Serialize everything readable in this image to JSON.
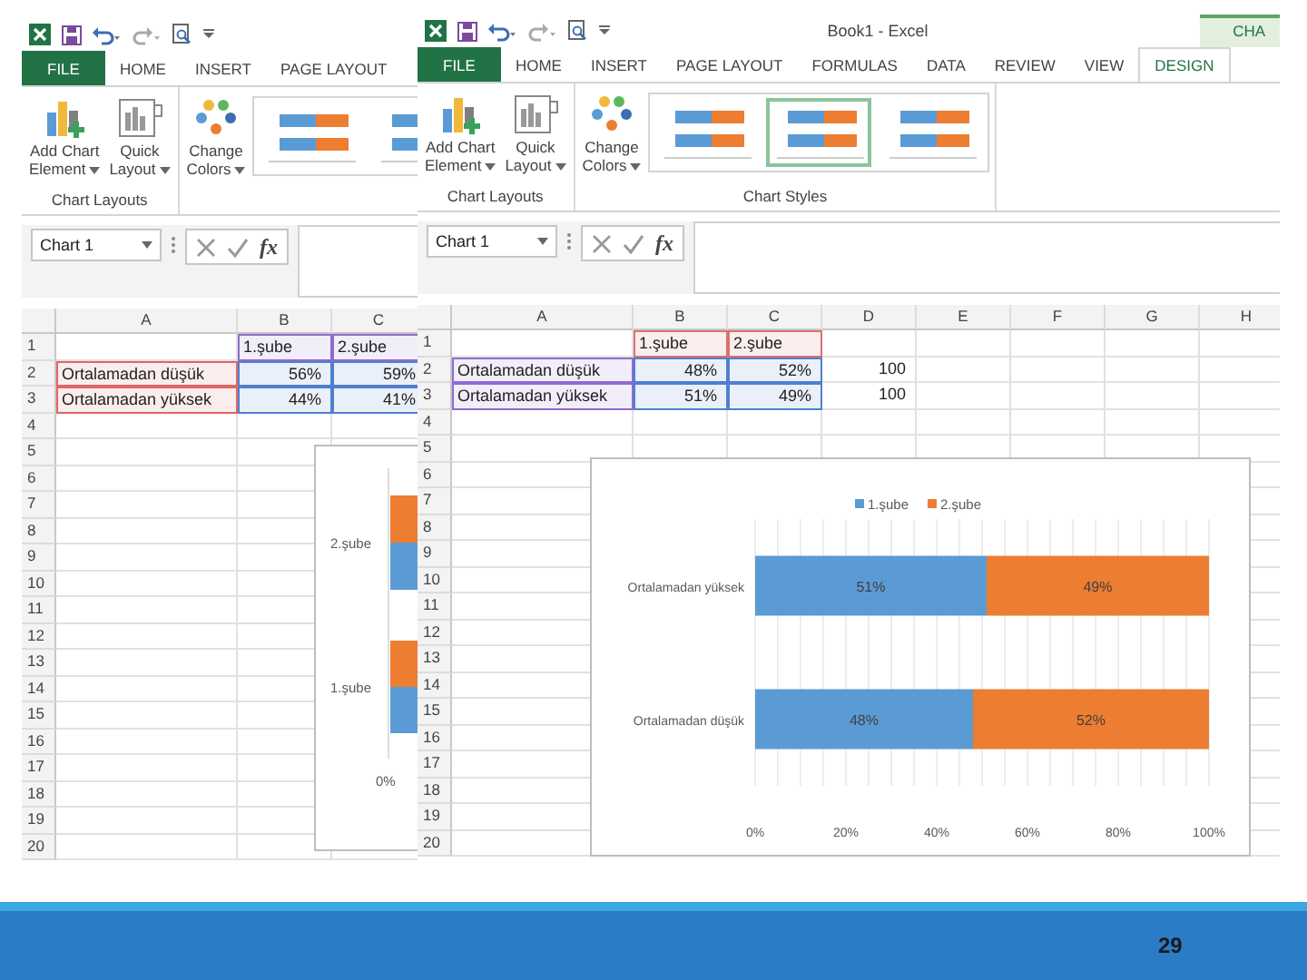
{
  "windows": [
    {
      "tabs": [
        {
          "label": "FILE",
          "kind": "file",
          "selected": false
        },
        {
          "label": "HOME",
          "kind": "tab",
          "selected": false
        },
        {
          "label": "INSERT",
          "kind": "tab",
          "selected": false
        },
        {
          "label": "PAGE LAYOUT",
          "kind": "tab",
          "selected": false
        }
      ],
      "ribbon_groups": [
        {
          "label": "Chart Layouts",
          "buttons": [
            {
              "lines": [
                "Add Chart",
                "Element"
              ],
              "kind": "add_element"
            },
            {
              "lines": [
                "Quick",
                "Layout"
              ],
              "kind": "layout"
            }
          ]
        },
        {
          "buttons": [
            {
              "lines": [
                "Change",
                "Colors"
              ],
              "kind": "colors"
            }
          ],
          "chart_styles": [
            {
              "selected": false
            },
            {
              "selected": false
            }
          ]
        }
      ],
      "name_box": "Chart 1",
      "function_label": "fx",
      "columns": [
        "A",
        "B",
        "C"
      ],
      "rows": [
        {
          "header": "1",
          "cells": [
            {},
            {
              "text": "1.şube",
              "color": "#8e6ccf"
            },
            {
              "text": "2.şube",
              "color": "#8e6ccf"
            }
          ]
        },
        {
          "header": "2",
          "cells": [
            {
              "text": "Ortalamadan düşük",
              "color": "#e06666"
            },
            {
              "text": "56%",
              "kind": "number",
              "color": "#4f7fd0"
            },
            {
              "text": "59%",
              "kind": "number",
              "color": "#4f7fd0"
            }
          ]
        },
        {
          "header": "3",
          "cells": [
            {
              "text": "Ortalamadan yüksek",
              "color": "#e06666"
            },
            {
              "text": "44%",
              "kind": "number",
              "color": "#4f7fd0"
            },
            {
              "text": "41%",
              "kind": "number",
              "color": "#4f7fd0"
            }
          ]
        },
        {
          "header": "4"
        },
        {
          "header": "5"
        },
        {
          "header": "6"
        },
        {
          "header": "7"
        },
        {
          "header": "8"
        },
        {
          "header": "9"
        },
        {
          "header": "10"
        },
        {
          "header": "11"
        },
        {
          "header": "12"
        },
        {
          "header": "13"
        },
        {
          "header": "14"
        },
        {
          "header": "15"
        },
        {
          "header": "16"
        },
        {
          "header": "17"
        },
        {
          "header": "18"
        },
        {
          "header": "19"
        },
        {
          "header": "20"
        }
      ],
      "chart": {
        "kind": "partial",
        "category_labels": [
          "2.şube",
          "1.şube"
        ],
        "axis_label": "0%"
      }
    },
    {
      "title_bar": {
        "title": "Book1 - Excel",
        "contextual_tab": "CHA"
      },
      "tabs": [
        {
          "label": "FILE",
          "kind": "file",
          "selected": false
        },
        {
          "label": "HOME",
          "kind": "tab",
          "selected": false
        },
        {
          "label": "INSERT",
          "kind": "tab",
          "selected": false
        },
        {
          "label": "PAGE LAYOUT",
          "kind": "tab",
          "selected": false
        },
        {
          "label": "FORMULAS",
          "kind": "tab",
          "selected": false
        },
        {
          "label": "DATA",
          "kind": "tab",
          "selected": false
        },
        {
          "label": "REVIEW",
          "kind": "tab",
          "selected": false
        },
        {
          "label": "VIEW",
          "kind": "tab",
          "selected": false
        },
        {
          "label": "DESIGN",
          "kind": "tab",
          "selected": true
        }
      ],
      "ribbon_groups": [
        {
          "label": "Chart Layouts",
          "buttons": [
            {
              "lines": [
                "Add Chart",
                "Element"
              ],
              "kind": "add_element"
            },
            {
              "lines": [
                "Quick",
                "Layout"
              ],
              "kind": "layout"
            }
          ]
        },
        {
          "label": "Chart Styles",
          "buttons": [
            {
              "lines": [
                "Change",
                "Colors"
              ],
              "kind": "colors"
            }
          ],
          "chart_styles": [
            {
              "selected": false
            },
            {
              "selected": true
            },
            {
              "selected": false
            }
          ]
        }
      ],
      "name_box": "Chart 1",
      "function_label": "fx",
      "columns": [
        "A",
        "B",
        "C",
        "D",
        "E",
        "F",
        "G",
        "H"
      ],
      "rows": [
        {
          "header": "1",
          "cells": [
            {},
            {
              "text": "1.şube",
              "color": "#d9726f"
            },
            {
              "text": "2.şube",
              "color": "#d9726f"
            }
          ]
        },
        {
          "header": "2",
          "cells": [
            {
              "text": "Ortalamadan düşük",
              "color": "#8e6ccf"
            },
            {
              "text": "48%",
              "kind": "number",
              "color": "#4f7fd0"
            },
            {
              "text": "52%",
              "kind": "number",
              "color": "#4f7fd0"
            },
            {
              "text": "100",
              "kind": "number"
            }
          ]
        },
        {
          "header": "3",
          "cells": [
            {
              "text": "Ortalamadan yüksek",
              "color": "#8e6ccf"
            },
            {
              "text": "51%",
              "kind": "number",
              "color": "#4f7fd0"
            },
            {
              "text": "49%",
              "kind": "number",
              "color": "#4f7fd0"
            },
            {
              "text": "100",
              "kind": "number"
            }
          ]
        },
        {
          "header": "4"
        },
        {
          "header": "5"
        },
        {
          "header": "6"
        },
        {
          "header": "7"
        },
        {
          "header": "8"
        },
        {
          "header": "9"
        },
        {
          "header": "10"
        },
        {
          "header": "11"
        },
        {
          "header": "12"
        },
        {
          "header": "13"
        },
        {
          "header": "14"
        },
        {
          "header": "15"
        },
        {
          "header": "16"
        },
        {
          "header": "17"
        },
        {
          "header": "18"
        },
        {
          "header": "19"
        },
        {
          "header": "20"
        }
      ],
      "chart": {
        "kind": "full",
        "chart_data": {
          "type": "bar",
          "orientation": "horizontal",
          "stacked": true,
          "categories": [
            "Ortalamadan yüksek",
            "Ortalamadan düşük"
          ],
          "series": [
            {
              "name": "1.şube",
              "color": "#5b9bd5",
              "values": [
                51,
                48
              ],
              "value_labels": [
                "51%",
                "48%"
              ]
            },
            {
              "name": "2.şube",
              "color": "#ed7d31",
              "values": [
                49,
                52
              ],
              "value_labels": [
                "49%",
                "52%"
              ]
            }
          ],
          "grid": true,
          "legend": "top",
          "xlim": [
            0,
            100
          ],
          "xticks": [
            {
              "value": 0,
              "label": "0%"
            },
            {
              "value": 20,
              "label": "20%"
            },
            {
              "value": 40,
              "label": "40%"
            },
            {
              "value": 60,
              "label": "60%"
            },
            {
              "value": 80,
              "label": "80%"
            },
            {
              "value": 100,
              "label": "100%"
            }
          ],
          "data_labels": true
        }
      }
    }
  ],
  "slide_number": "29"
}
